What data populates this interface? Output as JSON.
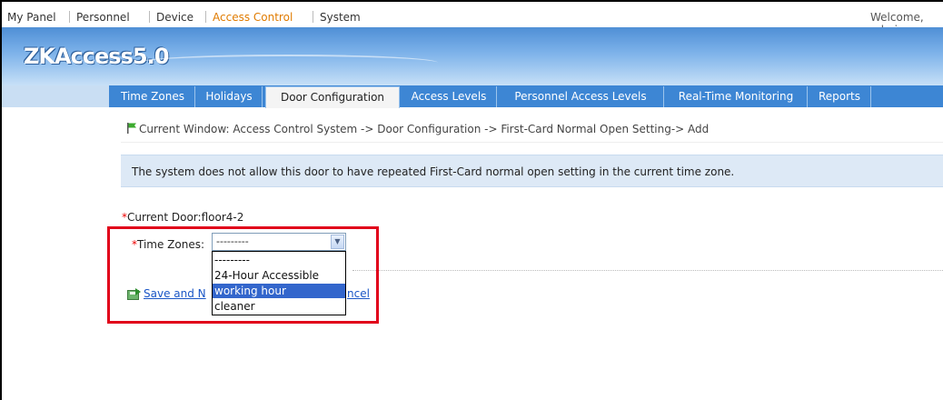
{
  "top_nav": {
    "items": [
      "My Panel",
      "Personnel",
      "Device",
      "Access Control",
      "System"
    ],
    "active": "Access Control",
    "welcome": "Welcome, admin"
  },
  "logo": "ZKAccess5.0",
  "tabs": [
    "Time Zones",
    "Holidays",
    "Door Configuration",
    "Access Levels",
    "Personnel Access Levels",
    "Real-Time Monitoring",
    "Reports"
  ],
  "active_tab": "Door Configuration",
  "breadcrumb": "Current Window: Access Control System -> Door Configuration -> First-Card Normal Open Setting-> Add",
  "notice": "The system does not allow this door to have repeated First-Card normal open setting in the current time zone.",
  "form": {
    "required_mark": "*",
    "current_door_label": "Current Door:",
    "current_door_value": "floor4-2",
    "time_zones_label": "Time Zones:",
    "time_zones_value": "---------",
    "time_zones_options": [
      "---------",
      "24-Hour Accessible",
      "working hour",
      "cleaner"
    ],
    "time_zones_highlighted": "working hour",
    "save_label_visible": "Save and N",
    "cancel_label_visible": "ncel"
  },
  "colors": {
    "accent_active": "#e07b00",
    "tab_bar": "#3d86d4",
    "highlight_box": "#e1001a",
    "option_selected": "#3366cc"
  }
}
